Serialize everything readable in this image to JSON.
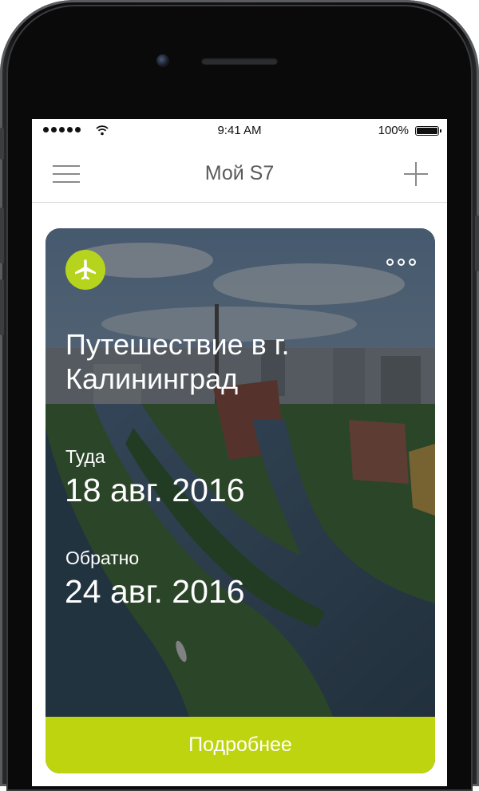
{
  "status_bar": {
    "time": "9:41 AM",
    "battery": "100%"
  },
  "nav": {
    "title": "Мой S7"
  },
  "trip": {
    "title_line1": "Путешествие в г.",
    "title_line2": "Калининград",
    "outbound_label": "Туда",
    "outbound_date": "18 авг. 2016",
    "return_label": "Обратно",
    "return_date": "24 авг. 2016",
    "details_label": "Подробнее"
  },
  "colors": {
    "accent": "#bdd40f",
    "badge": "#b6d41d",
    "title_text": "#5a5a5a"
  },
  "icons": [
    "menu-icon",
    "plus-icon",
    "plane-icon",
    "more-icon",
    "wifi-icon",
    "battery-icon",
    "signal-icon"
  ]
}
